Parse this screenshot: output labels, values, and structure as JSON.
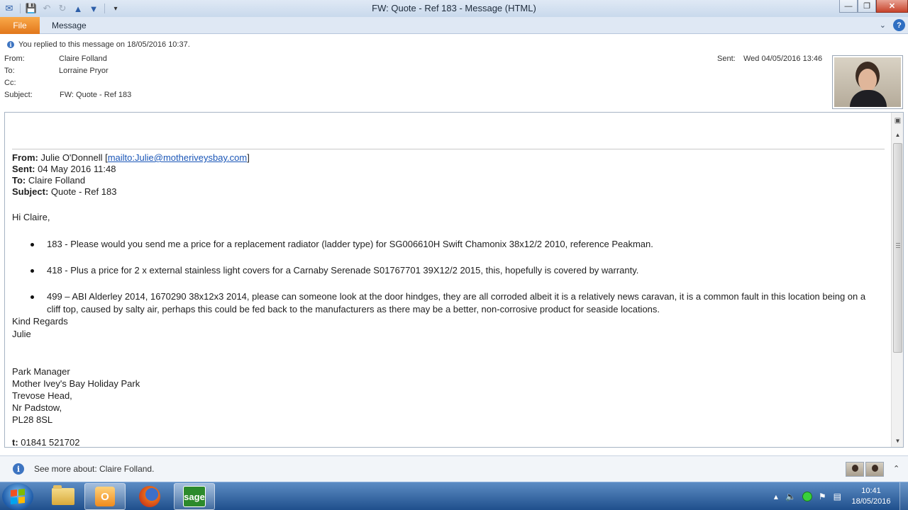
{
  "window": {
    "title": "FW: Quote - Ref 183  -  Message (HTML)",
    "minimize_icon": "minimize-icon",
    "maximize_icon": "restore-icon",
    "close_icon": "close-icon"
  },
  "quick_access": {
    "icons": [
      "save-icon",
      "undo-icon",
      "redo-icon",
      "previous-item-icon",
      "next-item-icon",
      "customize-icon"
    ]
  },
  "ribbon": {
    "file_tab": "File",
    "message_tab": "Message",
    "accent": "#e2771a"
  },
  "header": {
    "info": "You replied to this message on 18/05/2016 10:37.",
    "from_label": "From:",
    "from_value": "Claire Folland",
    "to_label": "To:",
    "to_value": "Lorraine Pryor",
    "cc_label": "Cc:",
    "cc_value": "",
    "subject_label": "Subject:",
    "subject_value": "FW: Quote - Ref 183",
    "sent_label": "Sent:",
    "sent_value": "Wed 04/05/2016 13:46"
  },
  "message": {
    "forward": {
      "from_label": "From:",
      "from_name": "Julie O'Donnell [",
      "from_link": "mailto:Julie@motheriveysbay.com",
      "from_close": "]",
      "sent_label": "Sent:",
      "sent_value": "04 May 2016 11:48",
      "to_label": "To:",
      "to_value": "Claire Folland",
      "subject_label": "Subject:",
      "subject_value": "Quote - Ref 183"
    },
    "greeting": "Hi Claire,",
    "bullets": [
      "183 - Please would you send me a price for a replacement radiator (ladder type) for SG006610H Swift Chamonix 38x12/2 2010, reference Peakman.",
      "418 - Plus a price for 2 x external stainless light covers for a Carnaby Serenade S01767701 39X12/2 2015, this, hopefully is covered by warranty.",
      "499 – ABI Alderley 2014, 1670290 38x12x3 2014, please can someone look at the door hindges, they are all corroded albeit it is a relatively news caravan, it is a common fault in this location being on a cliff top, caused by salty air, perhaps this could be fed back  to the manufacturers as there may be a better, non-corrosive product for seaside locations."
    ],
    "closing_1": "Kind Regards",
    "closing_2": "Julie",
    "signature": [
      "Park Manager",
      "Mother Ivey's Bay Holiday Park",
      "Trevose Head,",
      "Nr Padstow,",
      "PL28 8SL"
    ],
    "phone_label": "t:",
    "phone_value": "01841 521702"
  },
  "people_pane": {
    "text": "See more about: Claire Folland."
  },
  "taskbar": {
    "apps": [
      "windows-explorer-icon",
      "outlook-icon",
      "firefox-icon",
      "sage-icon"
    ],
    "sage_label": "sage",
    "time": "10:41",
    "date": "18/05/2016"
  }
}
